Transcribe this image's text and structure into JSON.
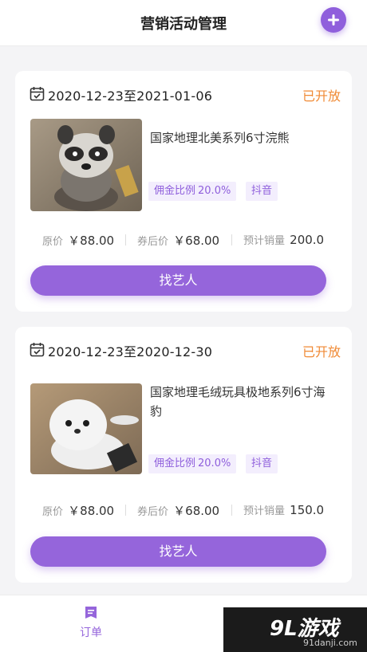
{
  "header": {
    "title": "营销活动管理"
  },
  "campaigns": [
    {
      "date_range": "2020-12-23至2021-01-06",
      "status": "已开放",
      "product_name": "国家地理北美系列6寸浣熊",
      "commission_label": "佣金比例",
      "commission_value": "20.0%",
      "platform": "抖音",
      "original_price_label": "原价",
      "original_price": "￥88.00",
      "coupon_price_label": "券后价",
      "coupon_price": "￥68.00",
      "expected_sales_label": "预计销量",
      "expected_sales": "200.0",
      "action_label": "找艺人"
    },
    {
      "date_range": "2020-12-23至2020-12-30",
      "status": "已开放",
      "product_name": "国家地理毛绒玩具极地系列6寸海豹",
      "commission_label": "佣金比例",
      "commission_value": "20.0%",
      "platform": "抖音",
      "original_price_label": "原价",
      "original_price": "￥88.00",
      "coupon_price_label": "券后价",
      "coupon_price": "￥68.00",
      "expected_sales_label": "预计销量",
      "expected_sales": "150.0",
      "action_label": "找艺人"
    }
  ],
  "tabbar": {
    "orders_label": "订单"
  },
  "watermark": {
    "logo": "9L游戏",
    "url": "91danji.com"
  },
  "colors": {
    "accent": "#9565db",
    "status": "#f08a35",
    "background": "#f4f4f6"
  },
  "icons": {
    "add": "plus-icon",
    "calendar": "calendar-icon",
    "orders": "order-icon"
  }
}
